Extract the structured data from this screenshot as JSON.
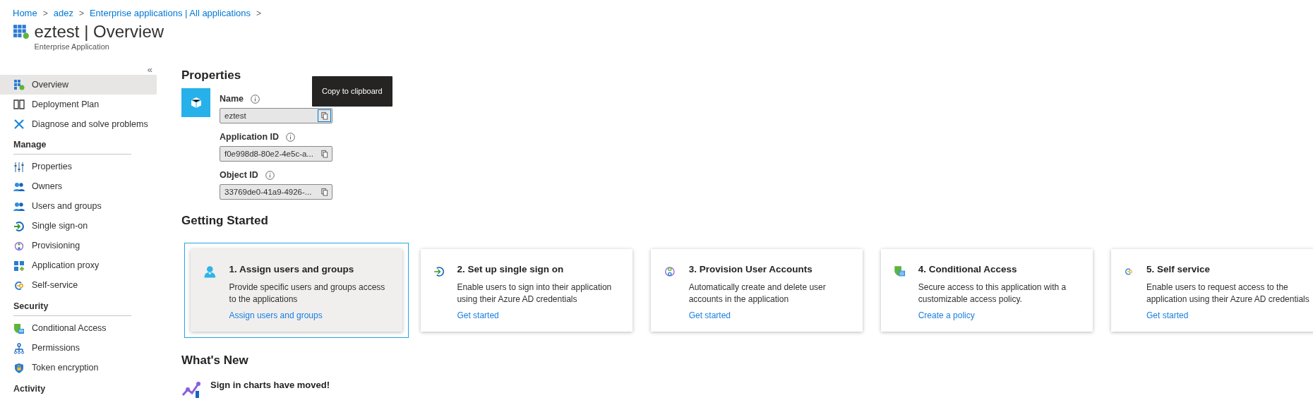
{
  "breadcrumb": [
    {
      "label": "Home",
      "separator": ">"
    },
    {
      "label": "adez",
      "separator": ">"
    },
    {
      "label": "Enterprise applications | All applications",
      "separator": ">"
    }
  ],
  "header": {
    "title": "eztest | Overview",
    "subtitle": "Enterprise Application"
  },
  "sidebar": {
    "collapse": "«",
    "items": [
      {
        "label": "Overview",
        "selected": true
      },
      {
        "label": "Deployment Plan",
        "selected": false
      },
      {
        "label": "Diagnose and solve problems",
        "selected": false
      }
    ],
    "sections": [
      {
        "title": "Manage",
        "items": [
          {
            "label": "Properties",
            "selected": false
          },
          {
            "label": "Owners",
            "selected": false
          },
          {
            "label": "Users and groups",
            "selected": false
          },
          {
            "label": "Single sign-on",
            "selected": false
          },
          {
            "label": "Provisioning",
            "selected": false
          },
          {
            "label": "Application proxy",
            "selected": false
          },
          {
            "label": "Self-service",
            "selected": false
          }
        ]
      },
      {
        "title": "Security",
        "items": [
          {
            "label": "Conditional Access",
            "selected": false
          },
          {
            "label": "Permissions",
            "selected": false
          },
          {
            "label": "Token encryption",
            "selected": false
          }
        ]
      },
      {
        "title": "Activity"
      }
    ]
  },
  "properties": {
    "title": "Properties",
    "fields": [
      {
        "label": "Name",
        "value": "eztest",
        "focused": true
      },
      {
        "label": "Application ID",
        "value": "f0e998d8-80e2-4e5c-a...",
        "focused": false
      },
      {
        "label": "Object ID",
        "value": "33769de0-41a9-4926-...",
        "focused": false
      }
    ],
    "tooltip": "Copy to clipboard"
  },
  "getting_started": {
    "title": "Getting Started",
    "cards": [
      {
        "title": "1. Assign users and groups",
        "description": "Provide specific users and groups access to the applications",
        "link": "Assign users and groups",
        "selected": true
      },
      {
        "title": "2. Set up single sign on",
        "description": "Enable users to sign into their application using their Azure AD credentials",
        "link": "Get started",
        "selected": false
      },
      {
        "title": "3. Provision User Accounts",
        "description": "Automatically create and delete user accounts in the application",
        "link": "Get started",
        "selected": false
      },
      {
        "title": "4. Conditional Access",
        "description": "Secure access to this application with a customizable access policy.",
        "link": "Create a policy",
        "selected": false
      },
      {
        "title": "5. Self service",
        "description": "Enable users to request access to the application using their Azure AD credentials",
        "link": "Get started",
        "selected": false
      }
    ]
  },
  "whats_new": {
    "title": "What's New",
    "items": [
      {
        "title": "Sign in charts have moved!"
      }
    ]
  }
}
